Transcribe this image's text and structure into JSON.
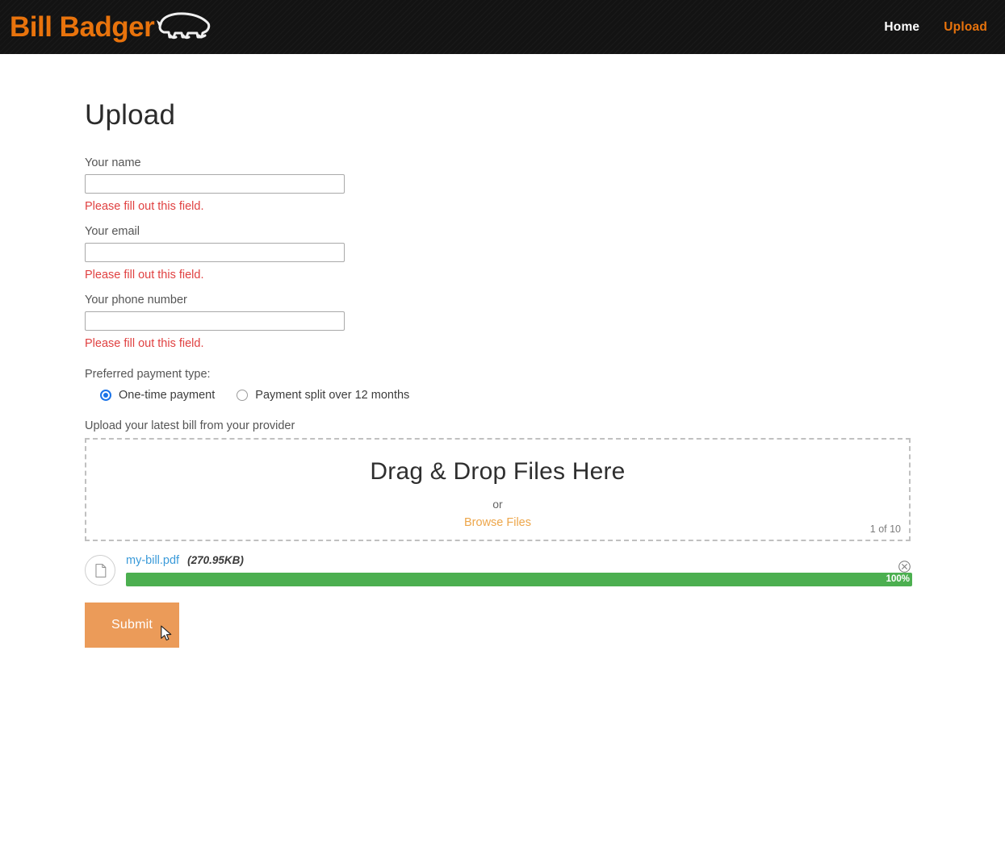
{
  "navbar": {
    "brand_text": "Bill Badger",
    "brand_logo_icon": "badger-logo-icon",
    "links": [
      {
        "label": "Home",
        "state": "active"
      },
      {
        "label": "Upload",
        "state": "current"
      }
    ],
    "colors": {
      "background": "#131313",
      "brand": "#e8730c",
      "link_active": "#ffffff"
    }
  },
  "page": {
    "title": "Upload"
  },
  "form": {
    "fields": [
      {
        "label": "Your name",
        "value": "",
        "error": "Please fill out this field."
      },
      {
        "label": "Your email",
        "value": "",
        "error": "Please fill out this field."
      },
      {
        "label": "Your phone number",
        "value": "",
        "error": "Please fill out this field."
      }
    ],
    "payment": {
      "group_label": "Preferred payment type:",
      "options": [
        {
          "label": "One-time payment",
          "selected": true
        },
        {
          "label": "Payment split over 12 months",
          "selected": false
        }
      ],
      "selected_color": "#1a73e8"
    },
    "submit_label": "Submit",
    "submit_color": "#eb9b59",
    "error_color": "#e04141"
  },
  "dropzone": {
    "label": "Upload your latest bill from your provider",
    "title": "Drag & Drop Files Here",
    "or_text": "or",
    "browse_label": "Browse Files",
    "browse_color": "#eda64a",
    "counter": "1 of 10"
  },
  "files": [
    {
      "icon": "document-icon",
      "name": "my-bill.pdf",
      "size": "(270.95KB)",
      "progress_label": "100%",
      "progress_value": 100,
      "progress_color": "#4caf50",
      "remove_icon": "circle-x-icon"
    }
  ],
  "cursor": {
    "icon": "arrow-pointer-icon"
  }
}
